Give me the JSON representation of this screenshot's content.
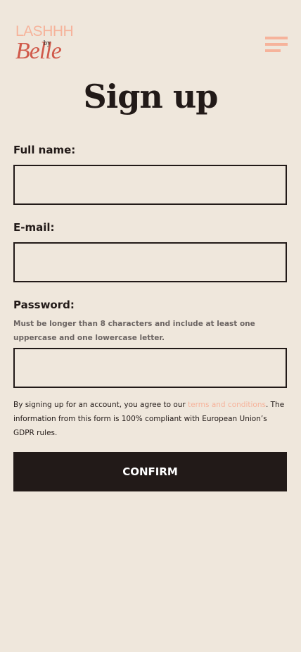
{
  "logo": {
    "top": "LASHHH",
    "by": "by",
    "name": "Belle"
  },
  "title": "Sign up",
  "fields": [
    {
      "label": "Full name:",
      "value": ""
    },
    {
      "label": "E-mail:",
      "value": ""
    },
    {
      "label": "Password:",
      "value": "",
      "hint": "Must be longer than 8 characters and include at least one uppercase and one lowercase letter."
    }
  ],
  "legal": {
    "before": "By signing up for an account, you agree to our ",
    "link": "terms and conditions",
    "after": ". The information from this form is 100% compliant with European Union’s GDPR rules."
  },
  "confirm_label": "CONFIRM",
  "colors": {
    "background": "#efe7dc",
    "accent": "#f6b39b",
    "dark": "#221a18"
  }
}
